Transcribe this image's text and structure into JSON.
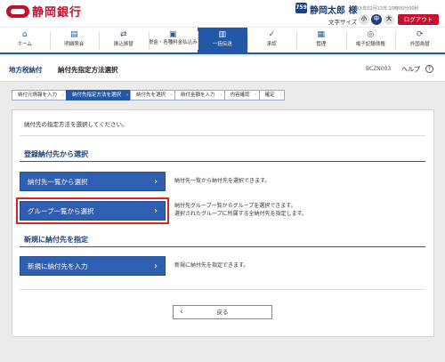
{
  "header": {
    "bank_name": "静岡銀行",
    "user_badge": "759",
    "user_name": "静岡太郎 様",
    "login_time": "20XX年02月13日 10時00分00秒",
    "font_size_label": "文字サイズ",
    "font_small": "小",
    "font_mid": "中",
    "font_large": "大",
    "logout": "ログアウト",
    "brand_color": "#c8102e"
  },
  "nav": [
    {
      "label": "ホーム",
      "icon": "home-icon",
      "glyph": "⌂"
    },
    {
      "label": "明細照会",
      "icon": "statement-icon",
      "glyph": "▤"
    },
    {
      "label": "振込振替",
      "icon": "transfer-icon",
      "glyph": "⇄"
    },
    {
      "label": "税金・各種料金払込み",
      "icon": "tax-payment-icon",
      "glyph": "▣"
    },
    {
      "label": "一括伝送",
      "icon": "batch-transmission-icon",
      "glyph": "▥"
    },
    {
      "label": "承認",
      "icon": "approval-icon",
      "glyph": "✓"
    },
    {
      "label": "管理",
      "icon": "management-icon",
      "glyph": "▦"
    },
    {
      "label": "電子記録債権",
      "icon": "electronic-claims-icon",
      "glyph": "◎"
    },
    {
      "label": "外国為替",
      "icon": "foreign-exchange-icon",
      "glyph": "⟳"
    }
  ],
  "page": {
    "category": "地方税納付",
    "title": "納付先指定方法選択",
    "screen_code": "BCZN003",
    "help": "ヘルプ"
  },
  "steps": [
    "納付元情報を入力",
    "納付先指定方法を選択",
    "納付先を選択",
    "納付金額を入力",
    "内容確認",
    "確定"
  ],
  "intro": "納付先の指定方法を選択してください。",
  "registered_section": {
    "title": "登録納付先から選択",
    "btn_list": "納付先一覧から選択",
    "desc_list": "納付先一覧から納付先を選択できます。",
    "btn_group": "グループ一覧から選択",
    "desc_group_1": "納付先グループ一覧からグループを選択できます。",
    "desc_group_2": "選択されたグループに所属する全納付先を指定します。"
  },
  "new_section": {
    "title": "新規に納付先を指定",
    "btn_new": "新規に納付先を入力",
    "desc_new": "新規に納付先を指定できます。"
  },
  "back": "戻る"
}
